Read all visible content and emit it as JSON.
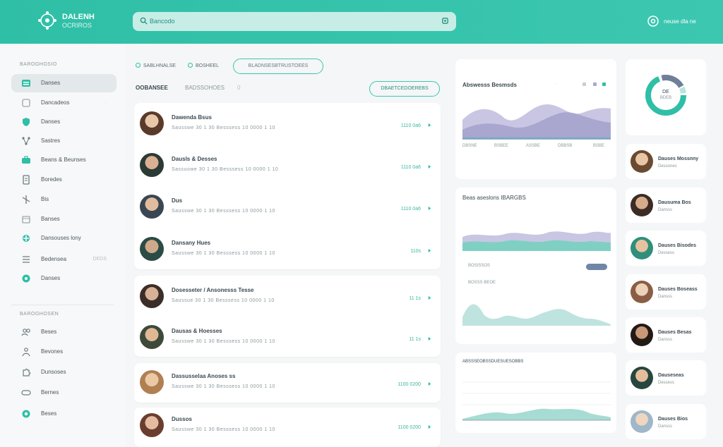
{
  "header": {
    "brand_name": "DALENH",
    "brand_sub": "OCRIROS",
    "search_placeholder": "Bancodo",
    "user_name": "neuse dla ne"
  },
  "sidebar": {
    "section1": "BAROGHOSIO",
    "items": [
      {
        "label": "Danses",
        "icon": "grid-icon"
      },
      {
        "label": "Dancadeos",
        "icon": "folder-icon"
      },
      {
        "label": "Danses",
        "icon": "shield-icon"
      },
      {
        "label": "Sastres",
        "icon": "network-icon"
      },
      {
        "label": "Beans & Beunses",
        "icon": "briefcase-icon"
      },
      {
        "label": "Boredes",
        "icon": "document-icon"
      },
      {
        "label": "Bis",
        "icon": "branch-icon"
      },
      {
        "label": "Banses",
        "icon": "archive-icon"
      },
      {
        "label": "Dansouses lony",
        "icon": "settings-icon"
      },
      {
        "label": "Bedensea",
        "icon": "layers-icon"
      },
      {
        "label": "Danses",
        "icon": "gear-icon"
      }
    ],
    "item_badges": {
      "dancadeos": "·",
      "bedensea": "DEDS"
    },
    "section2": "BAROGHOSEN",
    "items2": [
      {
        "label": "Beses",
        "icon": "people-icon"
      },
      {
        "label": "Bevones",
        "icon": "team-icon"
      },
      {
        "label": "Dunsoses",
        "icon": "puzzle-icon"
      },
      {
        "label": "Bernes",
        "icon": "tag-icon"
      },
      {
        "label": "Beses",
        "icon": "help-icon"
      }
    ]
  },
  "list": {
    "filters": [
      "SABLHNALSE",
      "BOSHEEL"
    ],
    "filter_pill": "BLADNSESBTRUSTOEES",
    "tabs": [
      "OOBANSEE",
      "BADSSOHOES",
      "0"
    ],
    "action_label": "DBAETCEDOEREBS",
    "rows": [
      {
        "name": "Dawenda Bsus",
        "meta": "Sausswe   30   1 30   Besssess   10 0000   1 10",
        "status": "1110 0a6"
      },
      {
        "name": "Dausls & Desses",
        "meta": "Sassuowe   30   1 30   Besssess   10 0000   1 10",
        "status": "1110 0a6"
      },
      {
        "name": "Dus",
        "meta": "Sausswe   30   1 30   Besssess   10 0000   1 10",
        "status": "1110 0a6"
      },
      {
        "name": "Dansany Hues",
        "meta": "Sausswe   30   1 30   Besssess   10 0000   1 10",
        "status": "110s"
      },
      {
        "name": "Dosesseter / Ansonesss Tesse",
        "meta": "Saussue   30   1 30   Besssess   10 0000   1 10",
        "status": "11 1s"
      },
      {
        "name": "Dausas & Hoesses",
        "meta": "Sausswe   30   1 30   Besssess   10 0000   1 10",
        "status": "11 1s"
      },
      {
        "name": "Dassusselaa Anoses ss",
        "meta": "Sausswe   30   1 30   Besssess   10 0000   1 10",
        "status": "1100 0200"
      },
      {
        "name": "Dussos",
        "meta": "Sausswe   30   1 30   Besssess   10 0000   1 10",
        "status": "1100 0200"
      }
    ]
  },
  "analytics": {
    "panel1_title": "Abswesss Besmsds",
    "panel1_legend": "·",
    "panel1_stats": [
      "DBSNE",
      "BSBEE",
      "ASSBE",
      "DBBSB",
      "BSBE"
    ],
    "panel2_title": "Beas aseslons IBARGBS",
    "panel2_sub": "BOSISSOS",
    "panel2_sub2": "BOSSS BEOE",
    "panel3_title": "ABSSSEOBSSDUESUESOBBS"
  },
  "people": [
    {
      "name": "Dauses Mossnny",
      "role": "Dessones"
    },
    {
      "name": "Dausuma Bos",
      "role": "Dansss"
    },
    {
      "name": "Dauses Bisodes",
      "role": "Dessess"
    },
    {
      "name": "Dauses Boseass",
      "role": "Dansss"
    },
    {
      "name": "Dauses Besas",
      "role": "Dansss"
    },
    {
      "name": "Dauseseas",
      "role": "Dessess"
    },
    {
      "name": "Dauses Bios",
      "role": "Dansss"
    }
  ],
  "donut": {
    "center_label": "DE",
    "center_sub": "BDEB"
  },
  "colors": {
    "accent": "#2fbfa6",
    "header": "#36c3ab",
    "chart_purple": "#a9a6cf",
    "chart_teal": "#7fd0c3"
  }
}
